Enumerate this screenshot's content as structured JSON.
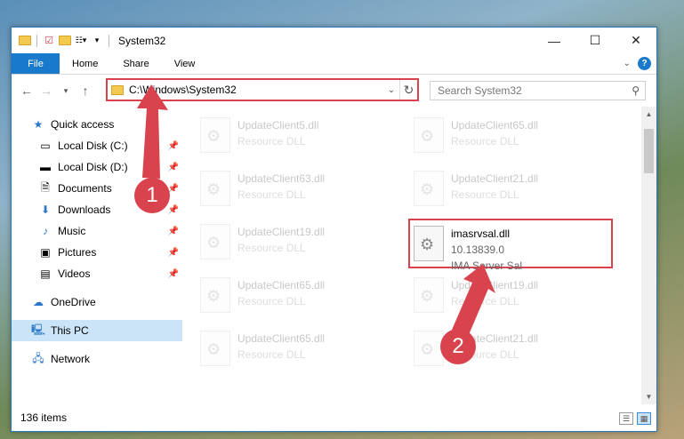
{
  "window": {
    "title": "System32"
  },
  "controls": {
    "minimize": "—",
    "maximize": "☐",
    "close": "✕"
  },
  "ribbon": {
    "tabs": [
      "File",
      "Home",
      "Share",
      "View"
    ],
    "help": "?"
  },
  "address": {
    "path": "C:\\Windows\\System32"
  },
  "search": {
    "placeholder": "Search System32"
  },
  "nav": {
    "items": [
      {
        "label": "Quick access",
        "icon": "star-icon"
      },
      {
        "label": "Local Disk (C:)",
        "icon": "drive-icon",
        "pinned": true
      },
      {
        "label": "Local Disk (D:)",
        "icon": "drive-icon",
        "pinned": true
      },
      {
        "label": "Documents",
        "icon": "documents-icon",
        "pinned": true
      },
      {
        "label": "Downloads",
        "icon": "downloads-icon",
        "pinned": true
      },
      {
        "label": "Music",
        "icon": "music-icon",
        "pinned": true
      },
      {
        "label": "Pictures",
        "icon": "pictures-icon",
        "pinned": true
      },
      {
        "label": "Videos",
        "icon": "videos-icon",
        "pinned": true
      },
      {
        "label": "OneDrive",
        "icon": "cloud-icon"
      },
      {
        "label": "This PC",
        "icon": "computer-icon",
        "selected": true
      },
      {
        "label": "Network",
        "icon": "network-icon"
      }
    ]
  },
  "files": [
    {
      "name": "UpdateClient5.dll",
      "desc": "Resource DLL"
    },
    {
      "name": "UpdateClient65.dll",
      "desc": "Resource DLL"
    },
    {
      "name": "UpdateClient63.dll",
      "desc": "Resource DLL"
    },
    {
      "name": "UpdateClient21.dll",
      "desc": "Resource DLL"
    },
    {
      "name": "UpdateClient19.dll",
      "desc": "Resource DLL"
    },
    {
      "name": "imasrvsal.dll",
      "version": "10.13839.0",
      "desc": "IMA Server Sal",
      "highlighted": true
    },
    {
      "name": "UpdateClient65.dll",
      "desc": "Resource DLL"
    },
    {
      "name": "UpdateClient19.dll",
      "desc": "Resource DLL"
    },
    {
      "name": "UpdateClient65.dll",
      "desc": "Resource DLL"
    },
    {
      "name": "UpdateClient21.dll",
      "desc": "Resource DLL"
    }
  ],
  "status": {
    "count": "136 items"
  },
  "annotations": {
    "step1": "1",
    "step2": "2"
  },
  "colors": {
    "accent": "#1979ca",
    "annotation": "#d9434e"
  }
}
